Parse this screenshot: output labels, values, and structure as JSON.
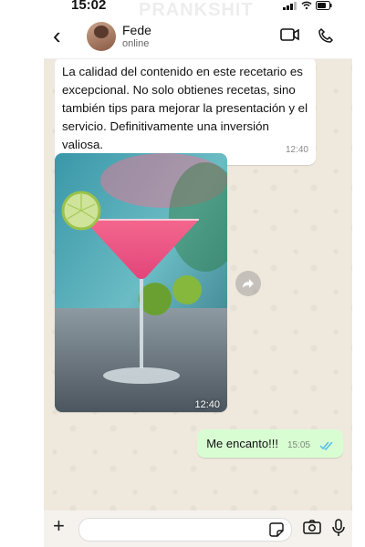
{
  "status_bar": {
    "time": "15:02",
    "watermark": "PRANKSHIT"
  },
  "header": {
    "back_icon": "chevron-left-icon",
    "contact_name": "Fede",
    "presence": "online",
    "icons": [
      "video-call-icon",
      "phone-call-icon"
    ]
  },
  "messages": [
    {
      "type": "text",
      "direction": "incoming",
      "text": "La calidad del contenido en este recetario es excepcional. No solo obtienes recetas, sino también tips para mejorar la presentación y el servicio. Definitivamente una inversión valiosa.",
      "time": "12:40"
    },
    {
      "type": "image",
      "direction": "incoming",
      "subject": "cosmopolitan cocktail with lime",
      "time": "12:40",
      "forward_icon": "forward-icon"
    },
    {
      "type": "text",
      "direction": "outgoing",
      "text": "Me encanto!!!",
      "time": "15:05",
      "status_icon": "double-check-icon",
      "status_color": "#53bdeb"
    }
  ],
  "composer": {
    "placeholder": "",
    "icons": [
      "plus-icon",
      "sticker-icon",
      "camera-icon",
      "mic-icon"
    ]
  },
  "colors": {
    "outgoing_bubble": "#d9fdd3",
    "incoming_bubble": "#ffffff",
    "chat_background": "#efe8dd"
  }
}
